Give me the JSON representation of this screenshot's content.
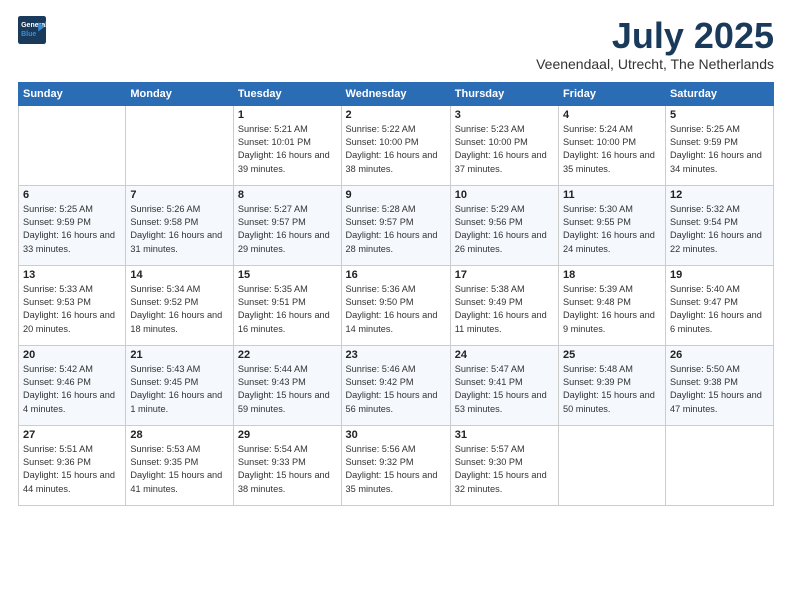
{
  "logo": {
    "line1": "General",
    "line2": "Blue"
  },
  "title": "July 2025",
  "location": "Veenendaal, Utrecht, The Netherlands",
  "headers": [
    "Sunday",
    "Monday",
    "Tuesday",
    "Wednesday",
    "Thursday",
    "Friday",
    "Saturday"
  ],
  "weeks": [
    [
      {
        "day": "",
        "detail": ""
      },
      {
        "day": "",
        "detail": ""
      },
      {
        "day": "1",
        "detail": "Sunrise: 5:21 AM\nSunset: 10:01 PM\nDaylight: 16 hours\nand 39 minutes."
      },
      {
        "day": "2",
        "detail": "Sunrise: 5:22 AM\nSunset: 10:00 PM\nDaylight: 16 hours\nand 38 minutes."
      },
      {
        "day": "3",
        "detail": "Sunrise: 5:23 AM\nSunset: 10:00 PM\nDaylight: 16 hours\nand 37 minutes."
      },
      {
        "day": "4",
        "detail": "Sunrise: 5:24 AM\nSunset: 10:00 PM\nDaylight: 16 hours\nand 35 minutes."
      },
      {
        "day": "5",
        "detail": "Sunrise: 5:25 AM\nSunset: 9:59 PM\nDaylight: 16 hours\nand 34 minutes."
      }
    ],
    [
      {
        "day": "6",
        "detail": "Sunrise: 5:25 AM\nSunset: 9:59 PM\nDaylight: 16 hours\nand 33 minutes."
      },
      {
        "day": "7",
        "detail": "Sunrise: 5:26 AM\nSunset: 9:58 PM\nDaylight: 16 hours\nand 31 minutes."
      },
      {
        "day": "8",
        "detail": "Sunrise: 5:27 AM\nSunset: 9:57 PM\nDaylight: 16 hours\nand 29 minutes."
      },
      {
        "day": "9",
        "detail": "Sunrise: 5:28 AM\nSunset: 9:57 PM\nDaylight: 16 hours\nand 28 minutes."
      },
      {
        "day": "10",
        "detail": "Sunrise: 5:29 AM\nSunset: 9:56 PM\nDaylight: 16 hours\nand 26 minutes."
      },
      {
        "day": "11",
        "detail": "Sunrise: 5:30 AM\nSunset: 9:55 PM\nDaylight: 16 hours\nand 24 minutes."
      },
      {
        "day": "12",
        "detail": "Sunrise: 5:32 AM\nSunset: 9:54 PM\nDaylight: 16 hours\nand 22 minutes."
      }
    ],
    [
      {
        "day": "13",
        "detail": "Sunrise: 5:33 AM\nSunset: 9:53 PM\nDaylight: 16 hours\nand 20 minutes."
      },
      {
        "day": "14",
        "detail": "Sunrise: 5:34 AM\nSunset: 9:52 PM\nDaylight: 16 hours\nand 18 minutes."
      },
      {
        "day": "15",
        "detail": "Sunrise: 5:35 AM\nSunset: 9:51 PM\nDaylight: 16 hours\nand 16 minutes."
      },
      {
        "day": "16",
        "detail": "Sunrise: 5:36 AM\nSunset: 9:50 PM\nDaylight: 16 hours\nand 14 minutes."
      },
      {
        "day": "17",
        "detail": "Sunrise: 5:38 AM\nSunset: 9:49 PM\nDaylight: 16 hours\nand 11 minutes."
      },
      {
        "day": "18",
        "detail": "Sunrise: 5:39 AM\nSunset: 9:48 PM\nDaylight: 16 hours\nand 9 minutes."
      },
      {
        "day": "19",
        "detail": "Sunrise: 5:40 AM\nSunset: 9:47 PM\nDaylight: 16 hours\nand 6 minutes."
      }
    ],
    [
      {
        "day": "20",
        "detail": "Sunrise: 5:42 AM\nSunset: 9:46 PM\nDaylight: 16 hours\nand 4 minutes."
      },
      {
        "day": "21",
        "detail": "Sunrise: 5:43 AM\nSunset: 9:45 PM\nDaylight: 16 hours\nand 1 minute."
      },
      {
        "day": "22",
        "detail": "Sunrise: 5:44 AM\nSunset: 9:43 PM\nDaylight: 15 hours\nand 59 minutes."
      },
      {
        "day": "23",
        "detail": "Sunrise: 5:46 AM\nSunset: 9:42 PM\nDaylight: 15 hours\nand 56 minutes."
      },
      {
        "day": "24",
        "detail": "Sunrise: 5:47 AM\nSunset: 9:41 PM\nDaylight: 15 hours\nand 53 minutes."
      },
      {
        "day": "25",
        "detail": "Sunrise: 5:48 AM\nSunset: 9:39 PM\nDaylight: 15 hours\nand 50 minutes."
      },
      {
        "day": "26",
        "detail": "Sunrise: 5:50 AM\nSunset: 9:38 PM\nDaylight: 15 hours\nand 47 minutes."
      }
    ],
    [
      {
        "day": "27",
        "detail": "Sunrise: 5:51 AM\nSunset: 9:36 PM\nDaylight: 15 hours\nand 44 minutes."
      },
      {
        "day": "28",
        "detail": "Sunrise: 5:53 AM\nSunset: 9:35 PM\nDaylight: 15 hours\nand 41 minutes."
      },
      {
        "day": "29",
        "detail": "Sunrise: 5:54 AM\nSunset: 9:33 PM\nDaylight: 15 hours\nand 38 minutes."
      },
      {
        "day": "30",
        "detail": "Sunrise: 5:56 AM\nSunset: 9:32 PM\nDaylight: 15 hours\nand 35 minutes."
      },
      {
        "day": "31",
        "detail": "Sunrise: 5:57 AM\nSunset: 9:30 PM\nDaylight: 15 hours\nand 32 minutes."
      },
      {
        "day": "",
        "detail": ""
      },
      {
        "day": "",
        "detail": ""
      }
    ]
  ]
}
